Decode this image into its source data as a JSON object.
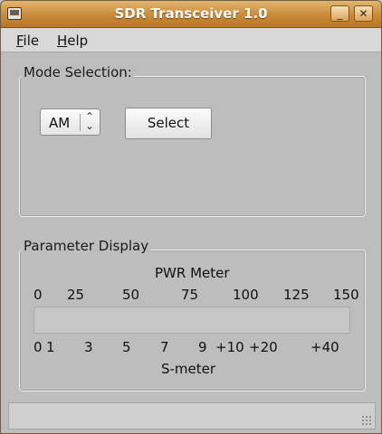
{
  "window": {
    "title": "SDR Transceiver 1.0",
    "minimize_label": "_",
    "close_label": "✕"
  },
  "menu": {
    "items": [
      {
        "label": "File"
      },
      {
        "label": "Help"
      }
    ]
  },
  "mode_selection": {
    "label": "Mode Selection:",
    "mode_value": "AM",
    "spin_icon": "updown-arrows-icon",
    "select_label": "Select"
  },
  "parameter_display": {
    "label": "Parameter Display",
    "pwr_meter": {
      "title": "PWR Meter",
      "ticks": [
        "0",
        "25",
        "50",
        "75",
        "100",
        "125",
        "150"
      ],
      "level": 0
    },
    "s_meter": {
      "title": "S-meter",
      "ticks": [
        "0",
        "1",
        "3",
        "5",
        "7",
        "9",
        "+10",
        "+20",
        "+40"
      ]
    }
  },
  "colors": {
    "titlebar": "#c98a39",
    "window_bg": "#bdbdbd",
    "bar_fill": "#6d8fbf"
  }
}
